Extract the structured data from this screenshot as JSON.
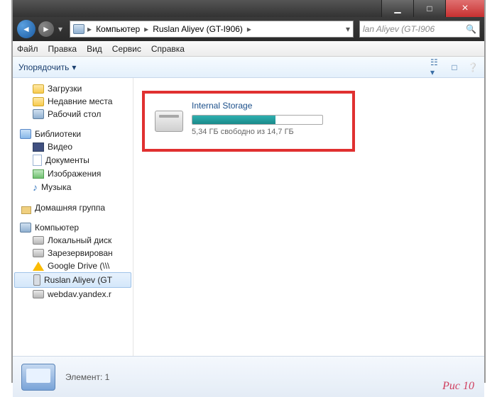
{
  "titlebar": {
    "min": "▁",
    "max": "□",
    "close": "×"
  },
  "nav": {
    "crumbs": [
      "Компьютер",
      "Ruslan Aliyev (GT-I906)"
    ],
    "sep": "▸",
    "dropdown": "▾",
    "search_placeholder": "lan Aliyev (GT-I906"
  },
  "menu": {
    "file": "Файл",
    "edit": "Правка",
    "view": "Вид",
    "service": "Сервис",
    "help": "Справка"
  },
  "toolbar": {
    "organize": "Упорядочить",
    "organize_arrow": "▾"
  },
  "tree": {
    "favorites": {
      "downloads": "Загрузки",
      "recent": "Недавние места",
      "desktop": "Рабочий стол"
    },
    "libraries": {
      "label": "Библиотеки",
      "video": "Видео",
      "documents": "Документы",
      "pictures": "Изображения",
      "music": "Музыка"
    },
    "homegroup": "Домашняя группа",
    "computer": {
      "label": "Компьютер",
      "localdisk": "Локальный диск",
      "reserved": "Зарезервирован",
      "gdrive": "Google Drive (\\\\\\",
      "phone": "Ruslan Aliyev (GT",
      "webdav": "webdav.yandex.r"
    }
  },
  "storage": {
    "title": "Internal Storage",
    "subtitle": "5,34 ГБ свободно из 14,7 ГБ",
    "fill_pct": 64
  },
  "details": {
    "text": "Элемент: 1"
  },
  "caption": "Рис 10"
}
